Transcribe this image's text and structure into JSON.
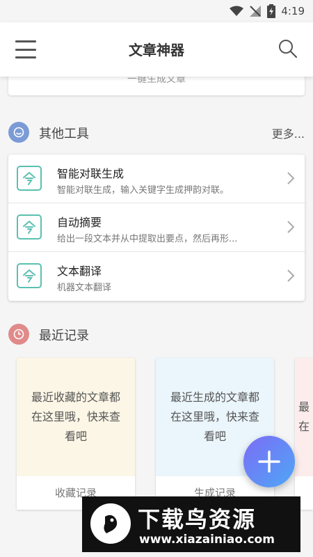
{
  "status_bar": {
    "time": "4:19"
  },
  "app_bar": {
    "title": "文章神器"
  },
  "previous_card": {
    "label": "一键生成文章"
  },
  "other_tools": {
    "title": "其他工具",
    "more": "更多...",
    "items": [
      {
        "name": "智能对联生成",
        "desc": "智能对联生成，输入关键字生成押韵对联。"
      },
      {
        "name": "自动摘要",
        "desc": "给出一段文本并从中提取出要点，然后再形..."
      },
      {
        "name": "文本翻译",
        "desc": "机器文本翻译"
      }
    ]
  },
  "recent": {
    "title": "最近记录",
    "cards": [
      {
        "body": "最近收藏的文章都在这里哦，快来查看吧",
        "footer": "收藏记录",
        "bg": "#fcf6e6"
      },
      {
        "body": "最近生成的文章都在这里哦，快来查看吧",
        "footer": "生成记录",
        "bg": "#eaf5fc"
      },
      {
        "body": "最在",
        "footer": "",
        "bg": "#fcecec"
      }
    ]
  },
  "watermark": {
    "name": "下载鸟资源",
    "url": "www.xiazainiao.com"
  },
  "colors": {
    "accent": "#5ac0b0",
    "tools_icon": "#7b9bd6",
    "recent_icon": "#e08a8a",
    "fab_start": "#7c6cf5",
    "fab_end": "#4ea7f7"
  },
  "icons": {
    "menu": "hamburger-icon",
    "search": "search-icon",
    "tool": "translate-icon",
    "chevron": "chevron-right-icon",
    "fab": "plus-icon"
  }
}
